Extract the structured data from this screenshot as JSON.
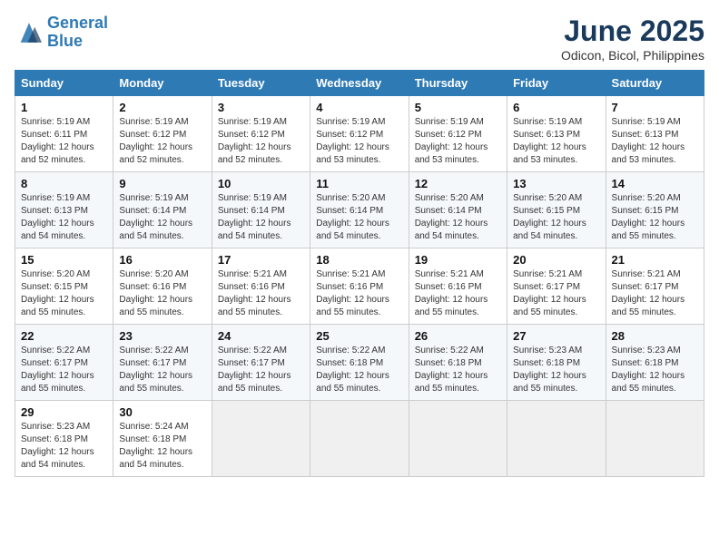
{
  "header": {
    "logo_line1": "General",
    "logo_line2": "Blue",
    "month": "June 2025",
    "location": "Odicon, Bicol, Philippines"
  },
  "weekdays": [
    "Sunday",
    "Monday",
    "Tuesday",
    "Wednesday",
    "Thursday",
    "Friday",
    "Saturday"
  ],
  "weeks": [
    [
      {
        "day": "1",
        "info": "Sunrise: 5:19 AM\nSunset: 6:11 PM\nDaylight: 12 hours\nand 52 minutes."
      },
      {
        "day": "2",
        "info": "Sunrise: 5:19 AM\nSunset: 6:12 PM\nDaylight: 12 hours\nand 52 minutes."
      },
      {
        "day": "3",
        "info": "Sunrise: 5:19 AM\nSunset: 6:12 PM\nDaylight: 12 hours\nand 52 minutes."
      },
      {
        "day": "4",
        "info": "Sunrise: 5:19 AM\nSunset: 6:12 PM\nDaylight: 12 hours\nand 53 minutes."
      },
      {
        "day": "5",
        "info": "Sunrise: 5:19 AM\nSunset: 6:12 PM\nDaylight: 12 hours\nand 53 minutes."
      },
      {
        "day": "6",
        "info": "Sunrise: 5:19 AM\nSunset: 6:13 PM\nDaylight: 12 hours\nand 53 minutes."
      },
      {
        "day": "7",
        "info": "Sunrise: 5:19 AM\nSunset: 6:13 PM\nDaylight: 12 hours\nand 53 minutes."
      }
    ],
    [
      {
        "day": "8",
        "info": "Sunrise: 5:19 AM\nSunset: 6:13 PM\nDaylight: 12 hours\nand 54 minutes."
      },
      {
        "day": "9",
        "info": "Sunrise: 5:19 AM\nSunset: 6:14 PM\nDaylight: 12 hours\nand 54 minutes."
      },
      {
        "day": "10",
        "info": "Sunrise: 5:19 AM\nSunset: 6:14 PM\nDaylight: 12 hours\nand 54 minutes."
      },
      {
        "day": "11",
        "info": "Sunrise: 5:20 AM\nSunset: 6:14 PM\nDaylight: 12 hours\nand 54 minutes."
      },
      {
        "day": "12",
        "info": "Sunrise: 5:20 AM\nSunset: 6:14 PM\nDaylight: 12 hours\nand 54 minutes."
      },
      {
        "day": "13",
        "info": "Sunrise: 5:20 AM\nSunset: 6:15 PM\nDaylight: 12 hours\nand 54 minutes."
      },
      {
        "day": "14",
        "info": "Sunrise: 5:20 AM\nSunset: 6:15 PM\nDaylight: 12 hours\nand 55 minutes."
      }
    ],
    [
      {
        "day": "15",
        "info": "Sunrise: 5:20 AM\nSunset: 6:15 PM\nDaylight: 12 hours\nand 55 minutes."
      },
      {
        "day": "16",
        "info": "Sunrise: 5:20 AM\nSunset: 6:16 PM\nDaylight: 12 hours\nand 55 minutes."
      },
      {
        "day": "17",
        "info": "Sunrise: 5:21 AM\nSunset: 6:16 PM\nDaylight: 12 hours\nand 55 minutes."
      },
      {
        "day": "18",
        "info": "Sunrise: 5:21 AM\nSunset: 6:16 PM\nDaylight: 12 hours\nand 55 minutes."
      },
      {
        "day": "19",
        "info": "Sunrise: 5:21 AM\nSunset: 6:16 PM\nDaylight: 12 hours\nand 55 minutes."
      },
      {
        "day": "20",
        "info": "Sunrise: 5:21 AM\nSunset: 6:17 PM\nDaylight: 12 hours\nand 55 minutes."
      },
      {
        "day": "21",
        "info": "Sunrise: 5:21 AM\nSunset: 6:17 PM\nDaylight: 12 hours\nand 55 minutes."
      }
    ],
    [
      {
        "day": "22",
        "info": "Sunrise: 5:22 AM\nSunset: 6:17 PM\nDaylight: 12 hours\nand 55 minutes."
      },
      {
        "day": "23",
        "info": "Sunrise: 5:22 AM\nSunset: 6:17 PM\nDaylight: 12 hours\nand 55 minutes."
      },
      {
        "day": "24",
        "info": "Sunrise: 5:22 AM\nSunset: 6:17 PM\nDaylight: 12 hours\nand 55 minutes."
      },
      {
        "day": "25",
        "info": "Sunrise: 5:22 AM\nSunset: 6:18 PM\nDaylight: 12 hours\nand 55 minutes."
      },
      {
        "day": "26",
        "info": "Sunrise: 5:22 AM\nSunset: 6:18 PM\nDaylight: 12 hours\nand 55 minutes."
      },
      {
        "day": "27",
        "info": "Sunrise: 5:23 AM\nSunset: 6:18 PM\nDaylight: 12 hours\nand 55 minutes."
      },
      {
        "day": "28",
        "info": "Sunrise: 5:23 AM\nSunset: 6:18 PM\nDaylight: 12 hours\nand 55 minutes."
      }
    ],
    [
      {
        "day": "29",
        "info": "Sunrise: 5:23 AM\nSunset: 6:18 PM\nDaylight: 12 hours\nand 54 minutes."
      },
      {
        "day": "30",
        "info": "Sunrise: 5:24 AM\nSunset: 6:18 PM\nDaylight: 12 hours\nand 54 minutes."
      },
      {
        "day": "",
        "info": ""
      },
      {
        "day": "",
        "info": ""
      },
      {
        "day": "",
        "info": ""
      },
      {
        "day": "",
        "info": ""
      },
      {
        "day": "",
        "info": ""
      }
    ]
  ]
}
